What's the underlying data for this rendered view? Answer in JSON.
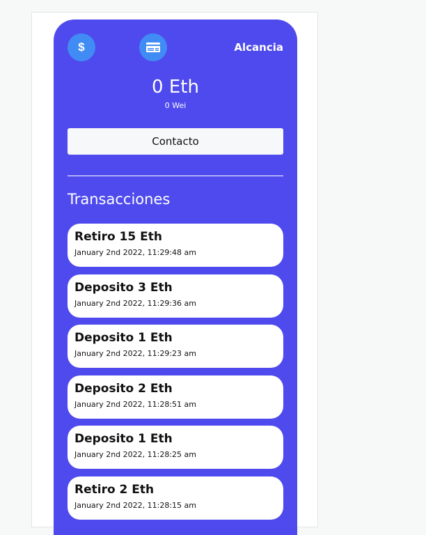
{
  "header": {
    "title": "Alcancia",
    "icons": [
      "dollar-icon",
      "credit-card-icon"
    ]
  },
  "balance": {
    "eth": "0 Eth",
    "wei": "0 Wei"
  },
  "contact_label": "Contacto",
  "transactions_title": "Transacciones",
  "transactions": [
    {
      "label": "Retiro 15 Eth",
      "date": "January 2nd 2022, 11:29:48 am"
    },
    {
      "label": "Deposito 3 Eth",
      "date": "January 2nd 2022, 11:29:36 am"
    },
    {
      "label": "Deposito 1 Eth",
      "date": "January 2nd 2022, 11:29:23 am"
    },
    {
      "label": "Deposito 2 Eth",
      "date": "January 2nd 2022, 11:28:51 am"
    },
    {
      "label": "Deposito 1 Eth",
      "date": "January 2nd 2022, 11:28:25 am"
    },
    {
      "label": "Retiro 2 Eth",
      "date": "January 2nd 2022, 11:28:15 am"
    }
  ],
  "colors": {
    "card": "#4f4aed",
    "circle": "#418cf4"
  }
}
